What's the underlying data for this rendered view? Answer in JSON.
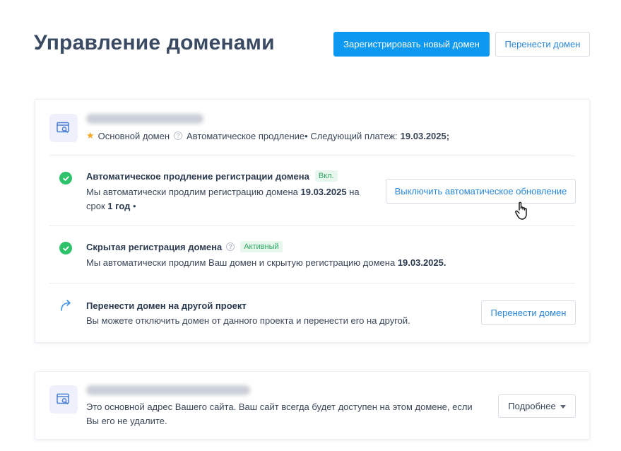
{
  "header": {
    "title": "Управление доменами",
    "register_label": "Зарегистрировать новый домен",
    "transfer_label": "Перенести домен"
  },
  "primary_domain": {
    "star_label": "Основной домен",
    "auto_renew_text": "Автоматическое продление• Следующий платеж:",
    "next_payment_date": "19.03.2025;",
    "rows": {
      "auto_renew": {
        "title": "Автоматическое продление регистрации домена",
        "tag": "Вкл.",
        "text_pre": "Мы автоматически продлим регистрацию домена",
        "date": "19.03.2025",
        "text_mid": "на",
        "text_term_pre": "срок",
        "term": "1 год",
        "text_post": "•",
        "button": "Выключить автоматическое обновление"
      },
      "privacy": {
        "title": "Скрытая регистрация домена",
        "tag": "Активный",
        "text_pre": "Мы автоматически продлим Ваш домен и скрытую регистрацию домена",
        "date": "19.03.2025."
      },
      "transfer": {
        "title": "Перенести домен на другой проект",
        "text": "Вы можете отключить домен от данного проекта и перенести его на другой.",
        "button": "Перенести домен"
      }
    }
  },
  "secondary_domain": {
    "text_line1": "Это основной адрес Вашего сайта. Ваш сайт всегда будет доступен на этом домене, если",
    "text_line2": "Вы его не удалите.",
    "more_button": "Подробнее"
  },
  "colors": {
    "primary": "#0d98f2",
    "success": "#2ec36b",
    "link": "#2b86d6"
  },
  "icons": {
    "domain": "domain-search-icon",
    "check": "check-circle-icon",
    "transfer": "share-arrow-icon",
    "star": "star-icon",
    "help": "question-circle-icon",
    "cursor": "hand-pointer-icon"
  }
}
